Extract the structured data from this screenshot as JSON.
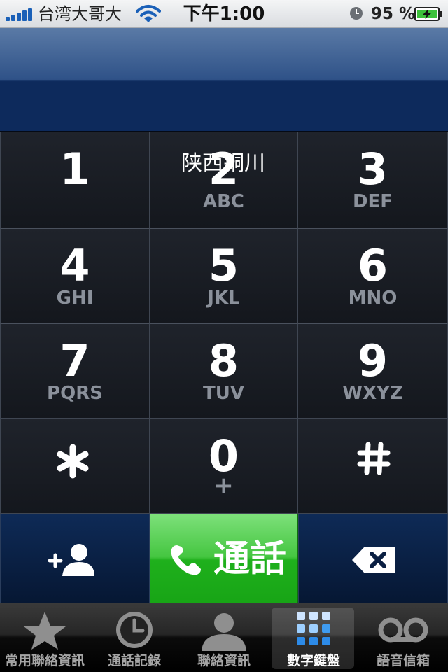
{
  "status_bar": {
    "carrier": "台湾大哥大",
    "time": "下午1:00",
    "battery_percent": "95 %"
  },
  "caller_location": "陕西铜川",
  "keypad": [
    {
      "num": "1",
      "letters": ""
    },
    {
      "num": "2",
      "letters": "ABC"
    },
    {
      "num": "3",
      "letters": "DEF"
    },
    {
      "num": "4",
      "letters": "GHI"
    },
    {
      "num": "5",
      "letters": "JKL"
    },
    {
      "num": "6",
      "letters": "MNO"
    },
    {
      "num": "7",
      "letters": "PQRS"
    },
    {
      "num": "8",
      "letters": "TUV"
    },
    {
      "num": "9",
      "letters": "WXYZ"
    },
    {
      "num": "",
      "letters": "",
      "icon": "asterisk-icon"
    },
    {
      "num": "0",
      "letters": "+"
    },
    {
      "num": "",
      "letters": "",
      "icon": "hash-icon"
    }
  ],
  "actions": {
    "add_contact_icon": "add-contact-icon",
    "call_label": "通話",
    "delete_icon": "backspace-icon"
  },
  "tabs": [
    {
      "label": "常用聯絡資訊",
      "icon": "star-icon"
    },
    {
      "label": "通話記錄",
      "icon": "clock-icon"
    },
    {
      "label": "聯絡資訊",
      "icon": "person-icon"
    },
    {
      "label": "數字鍵盤",
      "icon": "keypad-icon",
      "active": true
    },
    {
      "label": "語音信箱",
      "icon": "voicemail-icon"
    }
  ],
  "colors": {
    "call_green": "#2bb928",
    "display_blue": "#0d2a5c",
    "keypad_dark": "#1a1d24"
  }
}
